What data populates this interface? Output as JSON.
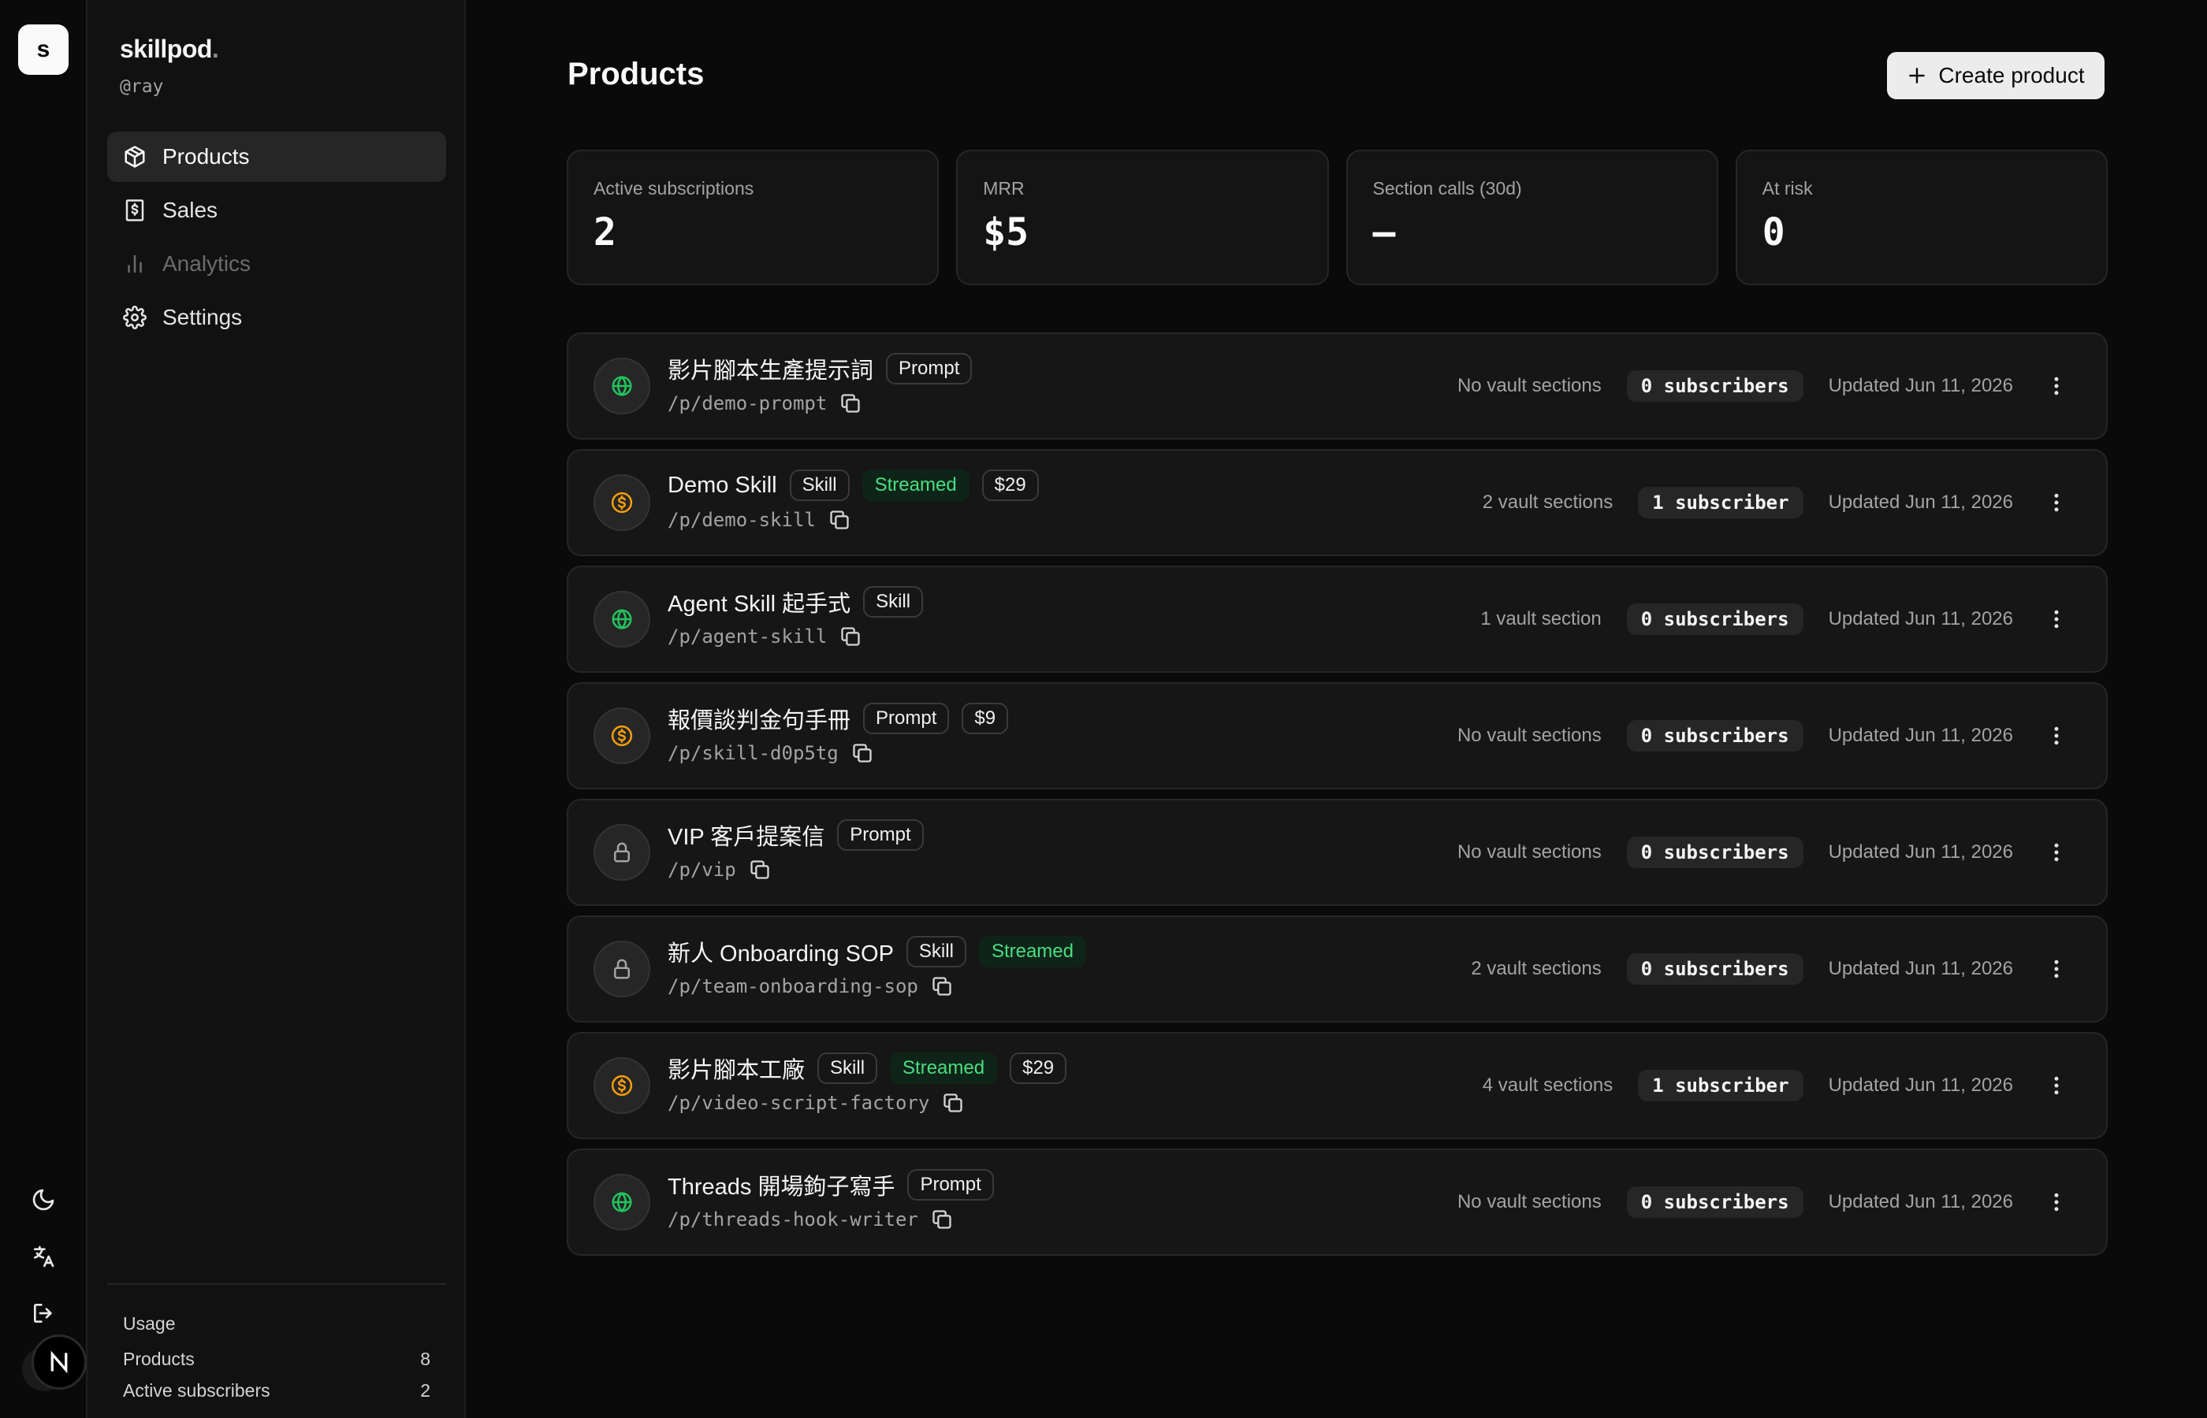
{
  "rail": {
    "logo_letter": "s",
    "avatar_letter": "N"
  },
  "sidebar": {
    "brand": "skillpod",
    "brand_dot": ".",
    "handle": "@ray",
    "nav": [
      {
        "label": "Products",
        "icon": "box-icon",
        "active": true
      },
      {
        "label": "Sales",
        "icon": "receipt-icon"
      },
      {
        "label": "Analytics",
        "icon": "bar-chart-icon",
        "disabled": true
      },
      {
        "label": "Settings",
        "icon": "gear-icon"
      }
    ],
    "usage": {
      "title": "Usage",
      "rows": [
        {
          "label": "Products",
          "value": "8"
        },
        {
          "label": "Active subscribers",
          "value": "2"
        }
      ]
    }
  },
  "header": {
    "title": "Products",
    "create_label": "Create product"
  },
  "stats": [
    {
      "label": "Active subscriptions",
      "value": "2"
    },
    {
      "label": "MRR",
      "value": "$5"
    },
    {
      "label": "Section calls (30d)",
      "value": "—"
    },
    {
      "label": "At risk",
      "value": "0"
    }
  ],
  "colors": {
    "globe": "#22c55e",
    "dollar": "#f59e0b",
    "lock": "#a3a3a3",
    "streamed": "#4ade80"
  },
  "products": [
    {
      "icon": "globe-icon",
      "name": "影片腳本生產提示詞",
      "type": "Prompt",
      "streamed": null,
      "price": null,
      "slug": "/p/demo-prompt",
      "vault": "No vault sections",
      "subs": "0 subscribers",
      "updated": "Updated Jun 11, 2026"
    },
    {
      "icon": "dollar-icon",
      "name": "Demo Skill",
      "type": "Skill",
      "streamed": "Streamed",
      "price": "$29",
      "slug": "/p/demo-skill",
      "vault": "2 vault sections",
      "subs": "1 subscriber",
      "updated": "Updated Jun 11, 2026"
    },
    {
      "icon": "globe-icon",
      "name": "Agent Skill 起手式",
      "type": "Skill",
      "streamed": null,
      "price": null,
      "slug": "/p/agent-skill",
      "vault": "1 vault section",
      "subs": "0 subscribers",
      "updated": "Updated Jun 11, 2026"
    },
    {
      "icon": "dollar-icon",
      "name": "報價談判金句手冊",
      "type": "Prompt",
      "streamed": null,
      "price": "$9",
      "slug": "/p/skill-d0p5tg",
      "vault": "No vault sections",
      "subs": "0 subscribers",
      "updated": "Updated Jun 11, 2026"
    },
    {
      "icon": "lock-icon",
      "name": "VIP 客戶提案信",
      "type": "Prompt",
      "streamed": null,
      "price": null,
      "slug": "/p/vip",
      "vault": "No vault sections",
      "subs": "0 subscribers",
      "updated": "Updated Jun 11, 2026"
    },
    {
      "icon": "lock-icon",
      "name": "新人 Onboarding SOP",
      "type": "Skill",
      "streamed": "Streamed",
      "price": null,
      "slug": "/p/team-onboarding-sop",
      "vault": "2 vault sections",
      "subs": "0 subscribers",
      "updated": "Updated Jun 11, 2026"
    },
    {
      "icon": "dollar-icon",
      "name": "影片腳本工廠",
      "type": "Skill",
      "streamed": "Streamed",
      "price": "$29",
      "slug": "/p/video-script-factory",
      "vault": "4 vault sections",
      "subs": "1 subscriber",
      "updated": "Updated Jun 11, 2026"
    },
    {
      "icon": "globe-icon",
      "name": "Threads 開場鉤子寫手",
      "type": "Prompt",
      "streamed": null,
      "price": null,
      "slug": "/p/threads-hook-writer",
      "vault": "No vault sections",
      "subs": "0 subscribers",
      "updated": "Updated Jun 11, 2026"
    }
  ]
}
